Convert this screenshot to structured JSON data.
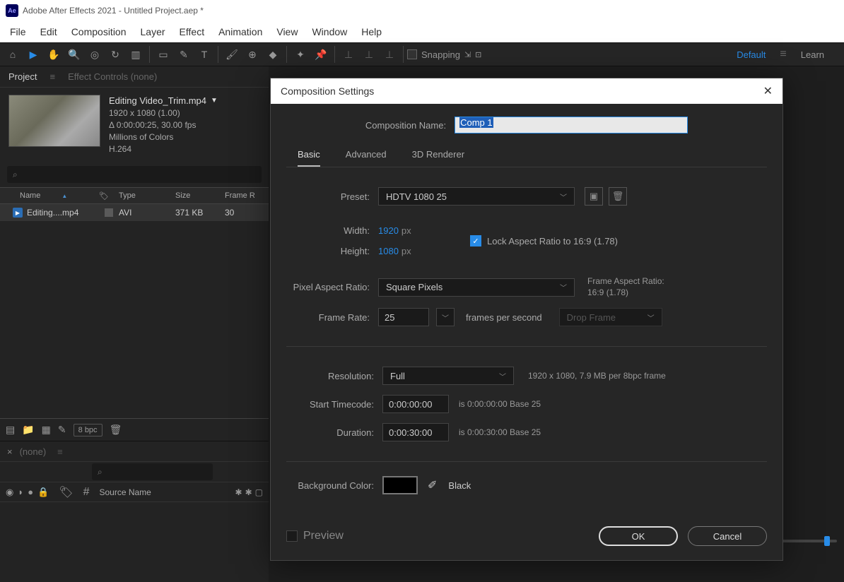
{
  "app": {
    "title": "Adobe After Effects 2021 - Untitled Project.aep *",
    "logo": "Ae"
  },
  "menu": [
    "File",
    "Edit",
    "Composition",
    "Layer",
    "Effect",
    "Animation",
    "View",
    "Window",
    "Help"
  ],
  "toolbar": {
    "snapping_label": "Snapping",
    "default_label": "Default",
    "learn_label": "Learn"
  },
  "project": {
    "tab_project": "Project",
    "tab_effect_controls": "Effect Controls (none)",
    "asset": {
      "name": "Editing Video_Trim.mp4",
      "dims": "1920 x 1080 (1.00)",
      "duration": "Δ 0:00:00:25, 30.00 fps",
      "colors": "Millions of Colors",
      "codec": "H.264"
    },
    "search_placeholder": "⌕",
    "columns": {
      "name": "Name",
      "type": "Type",
      "size": "Size",
      "frame_rate": "Frame R"
    },
    "rows": [
      {
        "name": "Editing....mp4",
        "type": "AVI",
        "size": "371 KB",
        "frame_rate": "30"
      }
    ],
    "footer": {
      "bpc": "8 bpc"
    }
  },
  "timeline": {
    "tab_none": "(none)",
    "hash": "#",
    "source_name": "Source Name"
  },
  "dialog": {
    "title": "Composition Settings",
    "comp_name_label": "Composition Name:",
    "comp_name_value": "Comp 1",
    "tabs": {
      "basic": "Basic",
      "advanced": "Advanced",
      "renderer": "3D Renderer"
    },
    "preset_label": "Preset:",
    "preset_value": "HDTV 1080 25",
    "width_label": "Width:",
    "width_value": "1920",
    "height_label": "Height:",
    "height_value": "1080",
    "px": "px",
    "lock_aspect": "Lock Aspect Ratio to 16:9 (1.78)",
    "par_label": "Pixel Aspect Ratio:",
    "par_value": "Square Pixels",
    "far_label": "Frame Aspect Ratio:",
    "far_value": "16:9 (1.78)",
    "framerate_label": "Frame Rate:",
    "framerate_value": "25",
    "framerate_units": "frames per second",
    "drop_frame": "Drop Frame",
    "resolution_label": "Resolution:",
    "resolution_value": "Full",
    "resolution_text": "1920 x 1080, 7.9 MB per 8bpc frame",
    "start_tc_label": "Start Timecode:",
    "start_tc_value": "0:00:00:00",
    "start_tc_text": "is 0:00:00:00  Base 25",
    "duration_label": "Duration:",
    "duration_value": "0:00:30:00",
    "duration_text": "is 0:00:30:00  Base 25",
    "bg_label": "Background Color:",
    "bg_name": "Black",
    "preview_label": "Preview",
    "ok": "OK",
    "cancel": "Cancel"
  }
}
